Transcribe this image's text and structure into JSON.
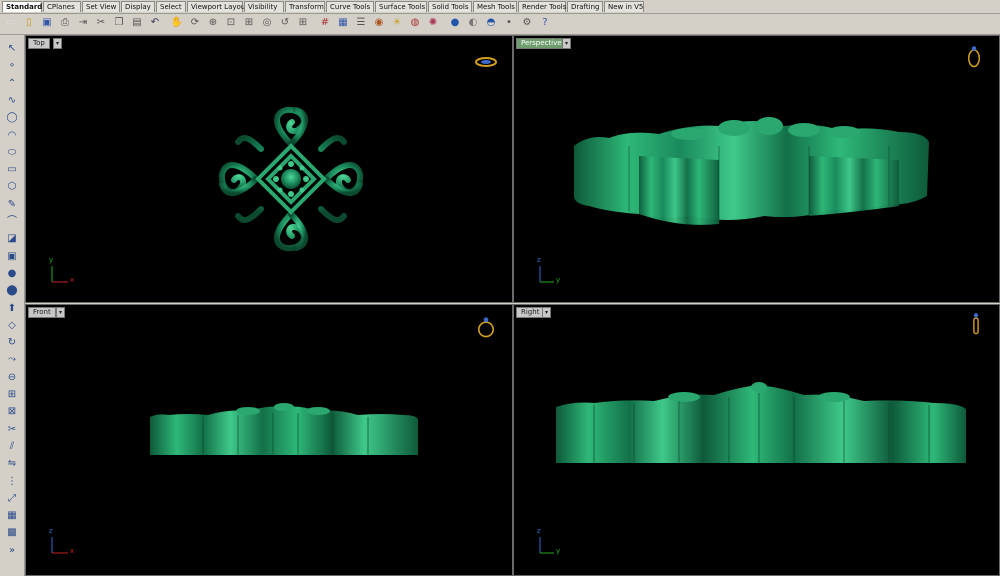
{
  "tabs": [
    {
      "label": "Standard",
      "active": true
    },
    {
      "label": "CPlanes"
    },
    {
      "label": "Set View"
    },
    {
      "label": "Display"
    },
    {
      "label": "Select"
    },
    {
      "label": "Viewport Layout"
    },
    {
      "label": "Visibility"
    },
    {
      "label": "Transform"
    },
    {
      "label": "Curve Tools"
    },
    {
      "label": "Surface Tools"
    },
    {
      "label": "Solid Tools"
    },
    {
      "label": "Mesh Tools"
    },
    {
      "label": "Render Tools"
    },
    {
      "label": "Drafting"
    },
    {
      "label": "New in V5"
    }
  ],
  "toolbar_icons": [
    "new-file-icon",
    "open-icon",
    "save-icon",
    "print-icon",
    "import-icon",
    "cut-icon",
    "copy-icon",
    "paste-icon",
    "undo-icon",
    "pan-icon",
    "rotate-view-icon",
    "zoom-icon",
    "zoom-window-icon",
    "zoom-extents-icon",
    "zoom-selected-icon",
    "undo-view-icon",
    "four-viewports-icon",
    "grid-icon",
    "layers-icon",
    "properties-icon",
    "object-snap-icon",
    "light-icon",
    "materials-icon",
    "color-wheel-icon",
    "render-icon",
    "sphere-render-icon",
    "environment-icon",
    "point-icon",
    "options-icon",
    "help-icon"
  ],
  "left_tools": [
    "select-icon",
    "point-icon",
    "polyline-icon",
    "curve-icon",
    "circle-icon",
    "arc-icon",
    "ellipse-icon",
    "rectangle-icon",
    "polygon-icon",
    "freeform-icon",
    "fillet-icon",
    "surface-icon",
    "box-icon",
    "sphere-icon",
    "cylinder-icon",
    "extrude-icon",
    "loft-icon",
    "revolve-icon",
    "sweep-icon",
    "boolean-icon",
    "join-icon",
    "explode-icon",
    "trim-icon",
    "split-icon",
    "mirror-icon",
    "array-icon",
    "scale-icon",
    "group-icon",
    "block-icon",
    "more-icon"
  ],
  "viewports": [
    {
      "name": "Top",
      "active": false,
      "axis": {
        "v": "y",
        "h": "x"
      },
      "widget": "top-view-ring-icon"
    },
    {
      "name": "Perspective",
      "active": true,
      "axis": {
        "v": "z",
        "h": "y"
      },
      "widget": "perspective-ring-icon"
    },
    {
      "name": "Front",
      "active": false,
      "axis": {
        "v": "z",
        "h": "x"
      },
      "widget": "front-view-ring-icon"
    },
    {
      "name": "Right",
      "active": false,
      "axis": {
        "v": "z",
        "h": "y"
      },
      "widget": "right-view-ring-icon"
    }
  ],
  "colors": {
    "model": "#1a8a5c",
    "model_light": "#3fc98a",
    "model_dark": "#0b4a2f",
    "axis_x": "#cc2222",
    "axis_y": "#22aa22",
    "axis_z": "#3a6acc",
    "widget": "#d4a020"
  }
}
